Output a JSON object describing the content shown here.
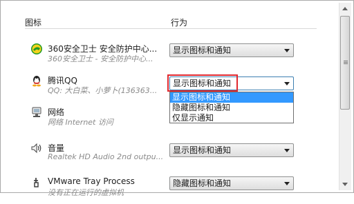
{
  "headers": {
    "icon": "图标",
    "behavior": "行为"
  },
  "rows": [
    {
      "name": "360安全卫士 安全防护中心...",
      "desc": "360安全卫士 - 安全防护中心...",
      "value": "显示图标和通知",
      "icon": "360-shield-icon"
    },
    {
      "name": "腾讯QQ",
      "desc": "QQ: 大白菜、小萝卜(136363...",
      "value": "显示图标和通知",
      "icon": "qq-penguin-icon"
    },
    {
      "name": "网络",
      "desc": "网络 Internet 访问",
      "value": "",
      "icon": "network-icon"
    },
    {
      "name": "音量",
      "desc": "Realtek HD Audio 2nd outpu...",
      "value": "显示图标和通知",
      "icon": "speaker-icon"
    },
    {
      "name": "VMware Tray Process",
      "desc": "没有正在运行的虚拟机",
      "value": "隐藏图标和通知",
      "icon": "vmware-tray-icon"
    }
  ],
  "dropdown_options": [
    "显示图标和通知",
    "隐藏图标和通知",
    "仅显示通知"
  ],
  "selected_option": "显示图标和通知",
  "colors": {
    "highlight_border": "#e0282e",
    "selection": "#3399ff"
  }
}
